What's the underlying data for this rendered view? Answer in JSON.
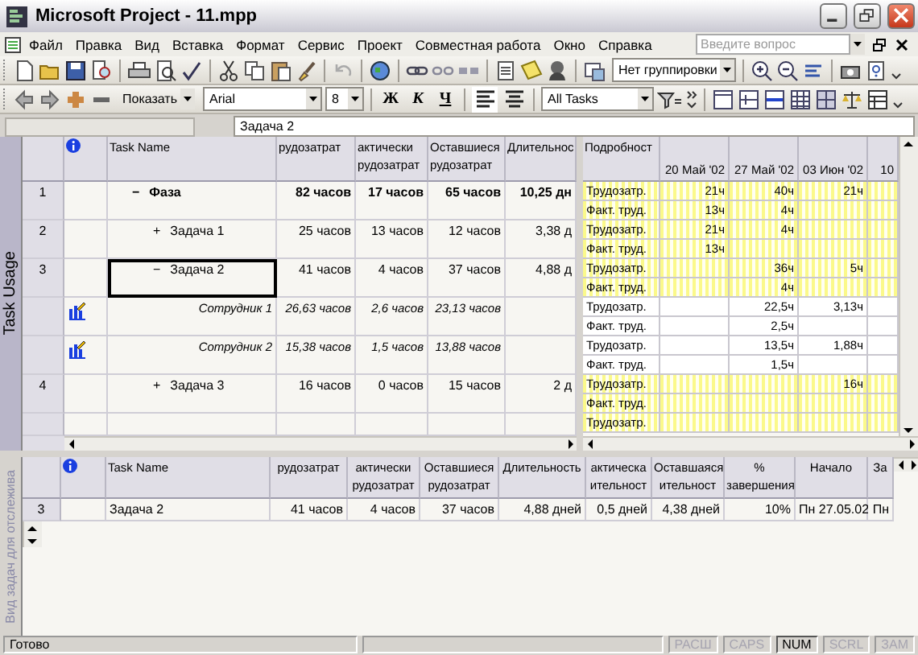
{
  "window": {
    "title": "Microsoft Project - 11.mpp"
  },
  "menu": {
    "items": [
      "Файл",
      "Правка",
      "Вид",
      "Вставка",
      "Формат",
      "Сервис",
      "Проект",
      "Совместная работа",
      "Окно",
      "Справка"
    ],
    "help_search": {
      "placeholder": "Введите вопрос"
    }
  },
  "standard_toolbar": {
    "grouping": "Нет группировки"
  },
  "formatting_toolbar": {
    "show": "Показать",
    "font": "Arial",
    "size": "8",
    "styles": [
      {
        "kind": "bold",
        "label": "Ж"
      },
      {
        "kind": "italic",
        "label": "К"
      },
      {
        "kind": "underline",
        "label": "Ч"
      }
    ],
    "align_buttons": [
      {
        "kind": "left",
        "pressed": true
      },
      {
        "kind": "center",
        "pressed": false
      }
    ],
    "filter": "All Tasks"
  },
  "entry_bar": {
    "value": "Задача 2"
  },
  "usage_view": {
    "label": "Task Usage",
    "columns": [
      "Task Name",
      "рудозатрат",
      "актически рудозатрат",
      "Оставшиеся рудозатрат",
      "Длительнос"
    ],
    "rows": [
      {
        "kind": "summary",
        "id": "1",
        "toggle": "−",
        "name": "Фаза",
        "work": "82 часов",
        "actual": "17 часов",
        "remaining": "65 часов",
        "duration": "10,25 дн",
        "selected": false,
        "children": [
          {
            "kind": "task",
            "id": "2",
            "toggle": "+",
            "name": "Задача 1",
            "work": "25 часов",
            "actual": "13 часов",
            "remaining": "12 часов",
            "duration": "3,38 д",
            "selected": false
          },
          {
            "kind": "task",
            "id": "3",
            "toggle": "−",
            "name": "Задача 2",
            "work": "41 часов",
            "actual": "4 часов",
            "remaining": "37 часов",
            "duration": "4,88 д",
            "selected": true,
            "children": [
              {
                "kind": "assignment",
                "name": "Сотрудник 1",
                "work": "26,63 часов",
                "actual": "2,6 часов",
                "remaining": "23,13 часов",
                "selected": false
              },
              {
                "kind": "assignment",
                "name": "Сотрудник 2",
                "work": "15,38 часов",
                "actual": "1,5 часов",
                "remaining": "13,88 часов",
                "selected": false
              }
            ]
          },
          {
            "kind": "task",
            "id": "4",
            "toggle": "+",
            "name": "Задача 3",
            "work": "16 часов",
            "actual": "0 часов",
            "remaining": "15 часов",
            "duration": "2 д",
            "selected": false
          }
        ]
      }
    ],
    "timephase": {
      "details_header": "Подробност",
      "dates": [
        "20 Май '02",
        "27 Май '02",
        "03 Июн '02",
        "10"
      ],
      "rows": [
        {
          "kind": "task",
          "label": "Трудозатр.",
          "week_1": "21ч",
          "week_2": "40ч",
          "week_3": "21ч"
        },
        {
          "kind": "task",
          "label": "Факт. труд.",
          "week_1": "13ч",
          "week_2": "4ч"
        },
        {
          "kind": "task",
          "label": "Трудозатр.",
          "week_1": "21ч",
          "week_2": "4ч"
        },
        {
          "kind": "task",
          "label": "Факт. труд.",
          "week_1": "13ч"
        },
        {
          "kind": "task",
          "label": "Трудозатр.",
          "week_2": "36ч",
          "week_3": "5ч"
        },
        {
          "kind": "task",
          "label": "Факт. труд.",
          "week_2": "4ч"
        },
        {
          "kind": "assignment",
          "label": "Трудозатр.",
          "week_2": "22,5ч",
          "week_3": "3,13ч"
        },
        {
          "kind": "assignment",
          "label": "Факт. труд.",
          "week_2": "2,5ч"
        },
        {
          "kind": "assignment",
          "label": "Трудозатр.",
          "week_2": "13,5ч",
          "week_3": "1,88ч"
        },
        {
          "kind": "assignment",
          "label": "Факт. труд.",
          "week_2": "1,5ч"
        },
        {
          "kind": "task",
          "label": "Трудозатр.",
          "week_3": "16ч"
        },
        {
          "kind": "task",
          "label": "Факт. труд."
        },
        {
          "kind": "task",
          "label": "Трудозатр."
        }
      ]
    }
  },
  "tracking_view": {
    "label": "Вид задач для отслежива",
    "columns": [
      "Task Name",
      "рудозатрат",
      "актически рудозатрат",
      "Оставшиеся рудозатрат",
      "Длительность",
      "актическа ительност",
      "Оставшаяся ительност",
      "% завершения",
      "Начало",
      "За"
    ],
    "rows": [
      {
        "id": "3",
        "cells": [
          "Задача 2",
          "41 часов",
          "4 часов",
          "37 часов",
          "4,88 дней",
          "0,5 дней",
          "4,38 дней",
          "10%",
          "Пн 27.05.02",
          "Пн"
        ]
      }
    ]
  },
  "status_bar": {
    "text": "Готово",
    "indicators": [
      {
        "label": "РАСШ",
        "on": false
      },
      {
        "label": "CAPS",
        "on": false
      },
      {
        "label": "NUM",
        "on": true
      },
      {
        "label": "SCRL",
        "on": false
      },
      {
        "label": "ЗАМ",
        "on": false
      }
    ]
  }
}
